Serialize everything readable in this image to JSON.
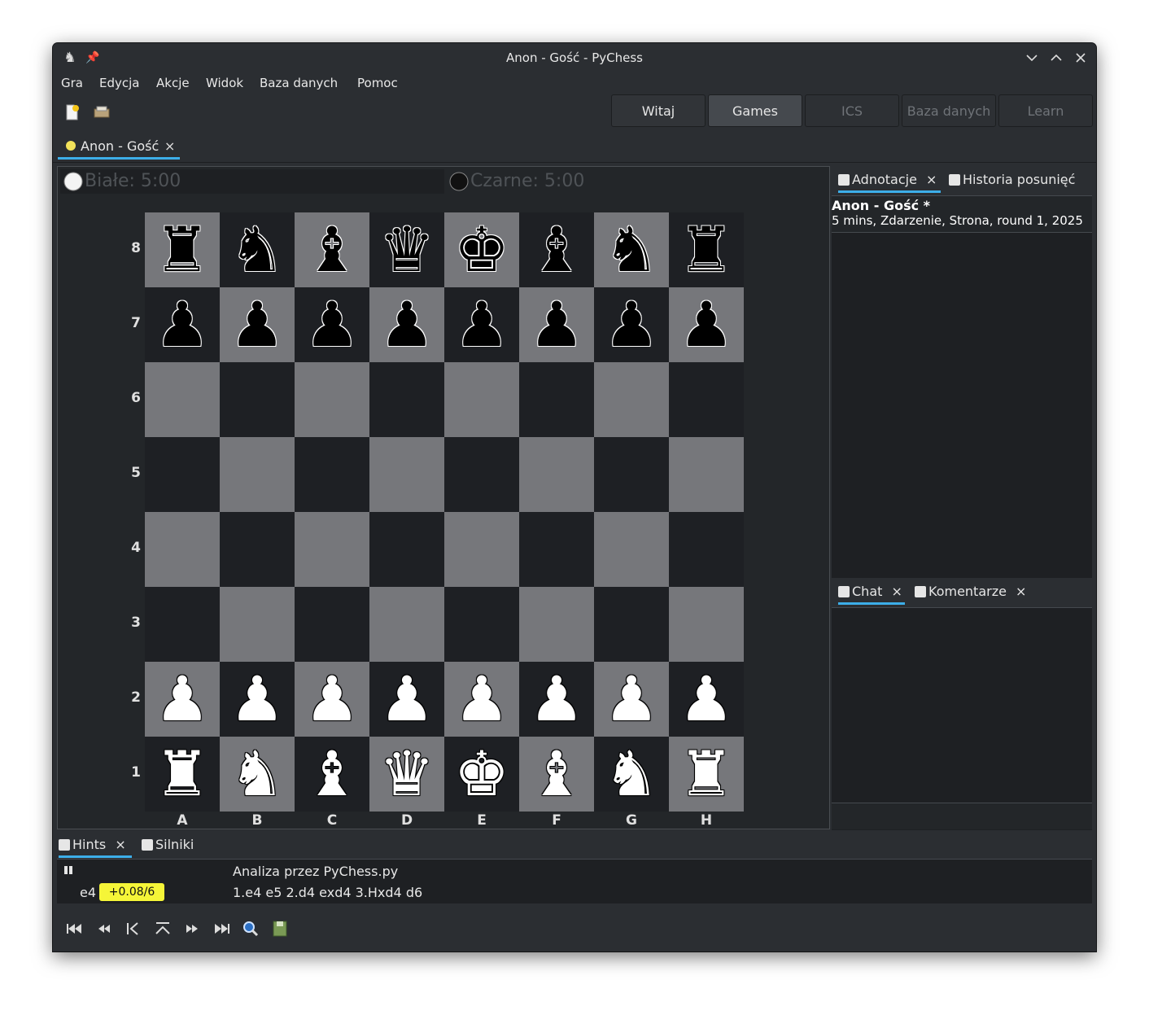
{
  "window": {
    "title": "Anon - Gość - PyChess"
  },
  "menu": [
    "Gra",
    "Edycja",
    "Akcje",
    "Widok",
    "Baza danych",
    "Pomoc"
  ],
  "perspectives": [
    {
      "label": "Witaj",
      "state": "normal"
    },
    {
      "label": "Games",
      "state": "active"
    },
    {
      "label": "ICS",
      "state": "disabled"
    },
    {
      "label": "Baza danych",
      "state": "disabled"
    },
    {
      "label": "Learn",
      "state": "disabled"
    }
  ],
  "game_tab": {
    "label": "Anon - Gość",
    "close": "×"
  },
  "clocks": {
    "white": "Białe: 5:00",
    "black": "Czarne: 5:00"
  },
  "board": {
    "ranks": [
      "8",
      "7",
      "6",
      "5",
      "4",
      "3",
      "2",
      "1"
    ],
    "files": [
      "A",
      "B",
      "C",
      "D",
      "E",
      "F",
      "G",
      "H"
    ],
    "position": [
      [
        "r",
        "n",
        "b",
        "q",
        "k",
        "b",
        "n",
        "r"
      ],
      [
        "p",
        "p",
        "p",
        "p",
        "p",
        "p",
        "p",
        "p"
      ],
      [
        "",
        "",
        "",
        "",
        "",
        "",
        "",
        ""
      ],
      [
        "",
        "",
        "",
        "",
        "",
        "",
        "",
        ""
      ],
      [
        "",
        "",
        "",
        "",
        "",
        "",
        "",
        ""
      ],
      [
        "",
        "",
        "",
        "",
        "",
        "",
        "",
        ""
      ],
      [
        "P",
        "P",
        "P",
        "P",
        "P",
        "P",
        "P",
        "P"
      ],
      [
        "R",
        "N",
        "B",
        "Q",
        "K",
        "B",
        "N",
        "R"
      ]
    ]
  },
  "right_panel": {
    "tabs": [
      {
        "label": "Adnotacje",
        "close": "×",
        "icon": "annotation-icon"
      },
      {
        "label": "Historia posunięć",
        "close": "×",
        "icon": "history-icon"
      }
    ],
    "annotation_title": "Anon - Gość *",
    "annotation_sub": "5 mins, Zdarzenie, Strona, round 1, 2025"
  },
  "bottom_right_panel": {
    "tabs": [
      {
        "label": "Chat",
        "close": "×",
        "icon": "chat-icon"
      },
      {
        "label": "Komentarze",
        "close": "×",
        "icon": "comments-icon"
      }
    ]
  },
  "hints_panel": {
    "tabs": [
      {
        "label": "Hints",
        "close": "×",
        "icon": "hints-icon"
      },
      {
        "label": "Silniki",
        "close": "×",
        "icon": "engines-icon"
      }
    ],
    "engine": "Analiza przez PyChess.py",
    "move": "e4",
    "score": "+0.08/6",
    "line": "1.e4 e5 2.d4 exd4 3.Hxd4 d6"
  }
}
